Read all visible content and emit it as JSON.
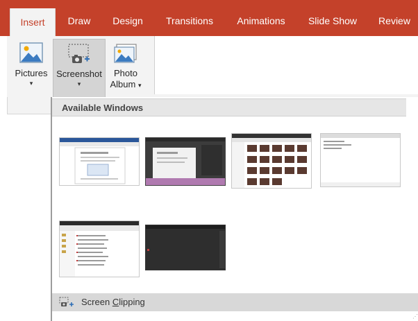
{
  "tabs": [
    {
      "label": "Insert",
      "active": true
    },
    {
      "label": "Draw"
    },
    {
      "label": "Design"
    },
    {
      "label": "Transitions"
    },
    {
      "label": "Animations"
    },
    {
      "label": "Slide Show"
    },
    {
      "label": "Review"
    }
  ],
  "ribbon": {
    "pictures": {
      "label": "Pictures",
      "icon": "pictures-icon"
    },
    "screenshot": {
      "label": "Screenshot",
      "icon": "screenshot-icon"
    },
    "photo_album": {
      "label_line1": "Photo",
      "label_line2": "Album",
      "icon": "photo-album-icon"
    }
  },
  "dropdown": {
    "header": "Available Windows",
    "windows": [
      {
        "name": "document window"
      },
      {
        "name": "dark editor window"
      },
      {
        "name": "photo gallery window"
      },
      {
        "name": "text window"
      },
      {
        "name": "file explorer window"
      },
      {
        "name": "dark window"
      }
    ],
    "screen_clipping": {
      "prefix": "Screen ",
      "underlined": "C",
      "suffix": "lipping",
      "icon": "screen-clipping-icon"
    }
  },
  "colors": {
    "accent": "#c4412a",
    "ribbon_bg": "#f3f3f3"
  }
}
